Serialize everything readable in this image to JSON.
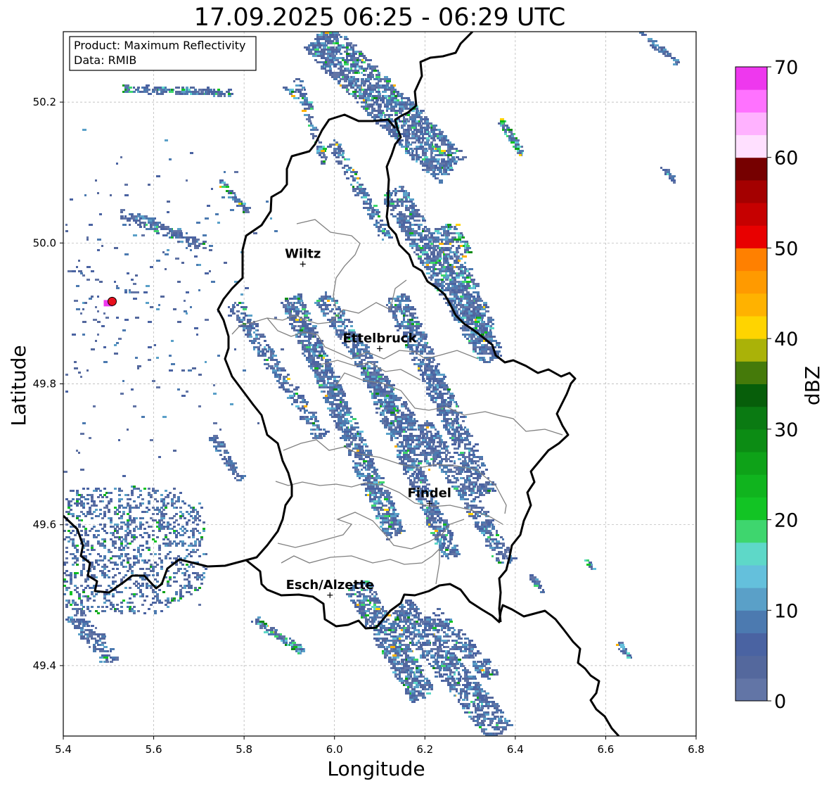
{
  "title": "17.09.2025 06:25 - 06:29 UTC",
  "info_box": {
    "product": "Product: Maximum Reflectivity",
    "data": "Data: RMIB"
  },
  "axes": {
    "xlabel": "Longitude",
    "ylabel": "Latitude",
    "xlim": [
      5.4,
      6.8
    ],
    "ylim": [
      49.3,
      50.3
    ],
    "x_ticks": [
      5.4,
      5.6,
      5.8,
      6.0,
      6.2,
      6.4,
      6.6,
      6.8
    ],
    "x_tick_labels": [
      "5.4",
      "5.6",
      "5.8",
      "6.0",
      "6.2",
      "6.4",
      "6.6",
      "6.8"
    ],
    "y_ticks": [
      49.4,
      49.6,
      49.8,
      50.0,
      50.2
    ],
    "y_tick_labels": [
      "49.4",
      "49.6",
      "49.8",
      "50.0",
      "50.2"
    ],
    "grid": true
  },
  "cities": [
    {
      "name": "Wiltz",
      "lon": 5.93,
      "lat": 49.97
    },
    {
      "name": "Ettelbruck",
      "lon": 6.1,
      "lat": 49.85
    },
    {
      "name": "Findel",
      "lon": 6.21,
      "lat": 49.63
    },
    {
      "name": "Esch/Alzette",
      "lon": 5.99,
      "lat": 49.5
    }
  ],
  "radar_site": {
    "lon": 5.505,
    "lat": 49.915,
    "color": "#e8101e"
  },
  "colorbar": {
    "label": "dBZ",
    "min": 0,
    "max": 70,
    "step": 2.5,
    "tick_values": [
      0,
      10,
      20,
      30,
      40,
      50,
      60,
      70
    ],
    "tick_labels": [
      "0",
      "10",
      "20",
      "30",
      "40",
      "50",
      "60",
      "70"
    ],
    "colors": [
      "#6275a6",
      "#54689d",
      "#4a63a2",
      "#4c7ab0",
      "#5aa0c8",
      "#64c0dc",
      "#5ed8c8",
      "#3ed66e",
      "#12c424",
      "#10b41e",
      "#0ea218",
      "#0c8c14",
      "#0a7a12",
      "#075e0a",
      "#457a0a",
      "#aab208",
      "#ffd400",
      "#ffb200",
      "#ff9a00",
      "#ff8000",
      "#e80000",
      "#c60000",
      "#a40000",
      "#760000",
      "#ffe0ff",
      "#ffb2ff",
      "#ff72ff",
      "#ee38ee"
    ]
  }
}
